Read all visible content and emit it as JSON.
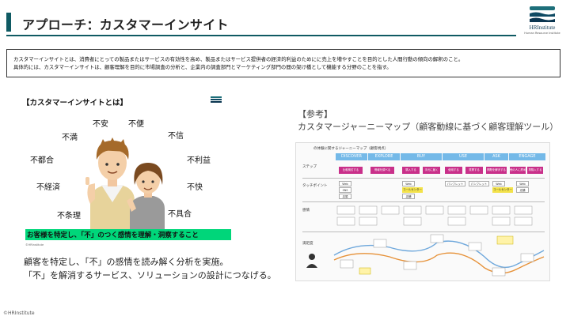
{
  "header": {
    "title": "アプローチ：カスタマーインサイト",
    "logo_text": "HRInstitute",
    "logo_sub": "Human Resource Institute"
  },
  "definition": {
    "line1": "カスタマーインサイトとは、消費者にとっての製品またはサービスの有効性を高め、製品またはサービス提供者の経済的利益のためにに売上を増やすことを目的とした人間行動の傾向の解釈のこと。",
    "line2": "具体的には、カスタマーインサイトは、顧客理解を目的に市場調査の分析と、企業内の調査部門とマーケティング部門の間の架け橋として機能する分野のことを指す。"
  },
  "insight_panel": {
    "heading": "【カスタマーインサイトとは】",
    "words": [
      "不安",
      "不便",
      "不満",
      "不信",
      "不都合",
      "不利益",
      "不経済",
      "不快",
      "不条理",
      "不具合"
    ],
    "banner": "お客様を特定し、「不」のつく感情を理解・洞察すること",
    "copyright": "©HRInstitute"
  },
  "summary": {
    "line1": "顧客を特定し、「不」の感情を読み解く分析を実施。",
    "line2": "「不」を解消するサービス、ソリューションの設計につなげる。"
  },
  "reference": {
    "label": "【参考】",
    "title": "カスタマージャーニーマップ（顧客動線に基づく顧客理解ツール）"
  },
  "journey_map": {
    "title": "の体験に関するジャーニーマップ（顧客視点）",
    "phases": [
      "DISCOVER",
      "EXPLORE",
      "BUY",
      "USE",
      "ASK",
      "ENGAGE"
    ],
    "row_labels": [
      "ステップ",
      "タッチポイント",
      "感情",
      "満足度"
    ],
    "steps": [
      "比較検討する",
      "情報を調べる",
      "購入する",
      "手元に届く",
      "使用する",
      "質問する",
      "問題を解決する",
      "他の人に薦める",
      "再購入する"
    ],
    "touchpoints": [
      "Web",
      "SNS",
      "店頭",
      "Web",
      "コールセンター",
      "店舗",
      "パンフレット",
      "パンフレット",
      "Web",
      "コールセンター",
      "Web",
      "店舗"
    ],
    "curve_notes": [
      "LINE",
      "ポイント",
      "困る",
      "いい感じ",
      "一番気分",
      "手間",
      "待ち"
    ]
  },
  "footer": {
    "copyright": "©HRInstitute"
  },
  "colors": {
    "accent": "#0f5a63",
    "banner": "#00d67a",
    "phase": "#74b9e8",
    "step": "#c9308a"
  }
}
